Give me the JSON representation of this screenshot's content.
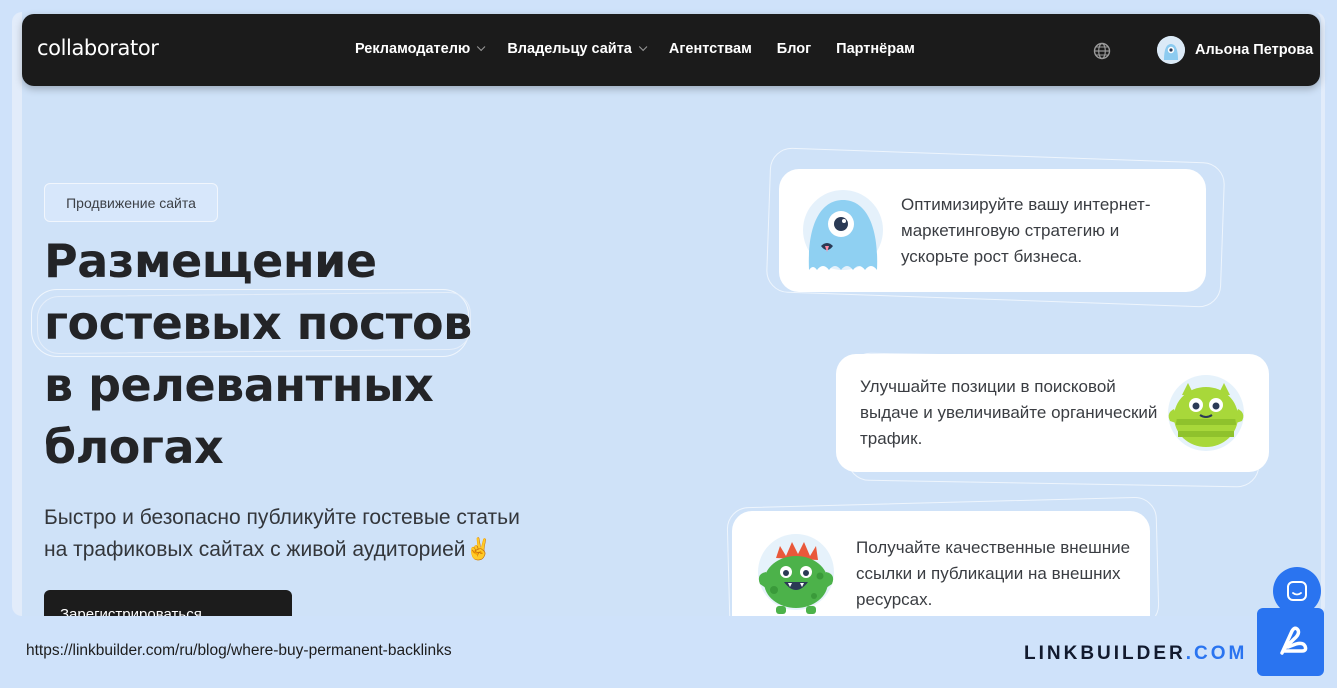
{
  "navbar": {
    "logo": "collaborator",
    "links": [
      {
        "label": "Рекламодателю",
        "dropdown": true
      },
      {
        "label": "Владельцу сайта",
        "dropdown": true
      },
      {
        "label": "Агентствам",
        "dropdown": false
      },
      {
        "label": "Блог",
        "dropdown": false
      },
      {
        "label": "Партнёрам",
        "dropdown": false
      }
    ],
    "language_icon": "globe-icon",
    "user_name": "Альона Петрова"
  },
  "hero": {
    "tag": "Продвижение сайта",
    "headline": [
      "Размещение",
      "гостевых постов",
      "в релевантных",
      "блогах"
    ],
    "subtitle_line1": "Быстро и безопасно публикуйте гостевые статьи",
    "subtitle_line2": "на трафиковых сайтах с живой аудиторией✌️",
    "cta_label": "Зарегистрироваться"
  },
  "cards": [
    {
      "text": "Оптимизируйте вашу интернет-маркетинговую стратегию и ускорьте рост бизнеса.",
      "mascot": "blue-one-eyed-monster-icon"
    },
    {
      "text": "Улучшайте позиции в поисковой выдаче и увеличивайте органический трафик.",
      "mascot": "green-striped-monster-icon"
    },
    {
      "text": "Получайте качественные внешние ссылки и публикации на внешних ресурсах.",
      "mascot": "green-spiky-monster-icon"
    }
  ],
  "footer": {
    "url": "https://linkbuilder.com/ru/blog/where-buy-permanent-backlinks",
    "brand_name": "LINKBUILDER",
    "brand_domain": ".COM"
  },
  "colors": {
    "accent": "#2a74f0",
    "nav_bg": "#1b1b1b",
    "page_bg": "#cfe2fa"
  }
}
